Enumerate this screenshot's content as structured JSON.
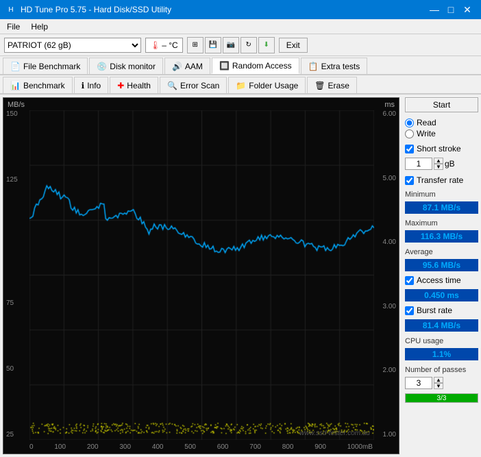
{
  "titleBar": {
    "title": "HD Tune Pro 5.75 - Hard Disk/SSD Utility",
    "controls": [
      "—",
      "□",
      "✕"
    ]
  },
  "menuBar": {
    "items": [
      "File",
      "Help"
    ]
  },
  "toolbar": {
    "driveSelect": "PATRIOT (62 gB)",
    "tempDisplay": "– °C",
    "exitLabel": "Exit"
  },
  "tabsTop": [
    {
      "label": "File Benchmark",
      "icon": "📄"
    },
    {
      "label": "Disk monitor",
      "icon": "💿"
    },
    {
      "label": "AAM",
      "icon": "🔊"
    },
    {
      "label": "Random Access",
      "icon": "🔲",
      "active": true
    },
    {
      "label": "Extra tests",
      "icon": "📋"
    }
  ],
  "tabsBottom": [
    {
      "label": "Benchmark",
      "icon": "📊"
    },
    {
      "label": "Info",
      "icon": "ℹ"
    },
    {
      "label": "Health",
      "icon": "➕"
    },
    {
      "label": "Error Scan",
      "icon": "🔍"
    },
    {
      "label": "Folder Usage",
      "icon": "📁"
    },
    {
      "label": "Erase",
      "icon": "🗑"
    }
  ],
  "chart": {
    "yAxisLeftLabel": "MB/s",
    "yAxisRightLabel": "ms",
    "yLeftValues": [
      "150",
      "125",
      "75",
      "50",
      "25"
    ],
    "yRightValues": [
      "6.00",
      "5.00",
      "4.00",
      "3.00",
      "2.00",
      "1.00"
    ],
    "xAxisValues": [
      "0",
      "100",
      "200",
      "300",
      "400",
      "500",
      "600",
      "700",
      "800",
      "900",
      "1000mB"
    ],
    "watermark": "www.ssd-tester.com.au"
  },
  "rightPanel": {
    "startButton": "Start",
    "readLabel": "Read",
    "writeLabel": "Write",
    "shortStrokeLabel": "Short stroke",
    "shortStrokeValue": "1",
    "shortStrokeUnit": "gB",
    "transferRateLabel": "Transfer rate",
    "minimumLabel": "Minimum",
    "minimumValue": "87.1 MB/s",
    "maximumLabel": "Maximum",
    "maximumValue": "116.3 MB/s",
    "averageLabel": "Average",
    "averageValue": "95.6 MB/s",
    "accessTimeLabel": "Access time",
    "accessTimeValue": "0.450 ms",
    "burstRateLabel": "Burst rate",
    "burstRateValue": "81.4 MB/s",
    "cpuUsageLabel": "CPU usage",
    "cpuUsageValue": "1.1%",
    "passesLabel": "Number of passes",
    "passesValue": "3",
    "progressText": "3/3",
    "progressPercent": 100
  }
}
